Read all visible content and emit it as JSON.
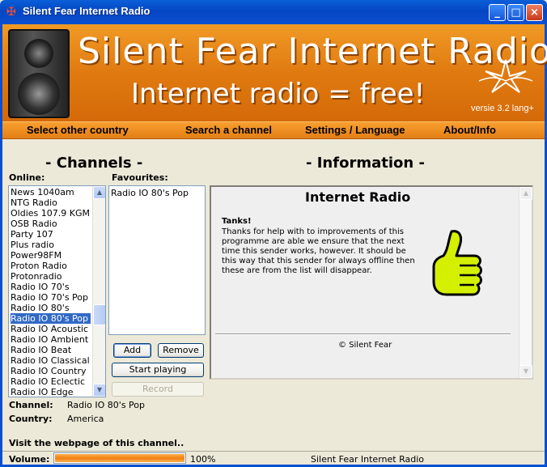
{
  "window": {
    "title": "Silent Fear Internet Radio",
    "icon": "app-logo-icon",
    "controls": {
      "minimize": "_",
      "maximize": "□",
      "close": "×"
    }
  },
  "banner": {
    "title": "Silent Fear Internet Radio",
    "slogan": "Internet radio = free!",
    "version": "versie 3.2 lang+"
  },
  "menu": {
    "items": [
      "Select other country",
      "Search a channel",
      "Settings / Language",
      "About/Info"
    ]
  },
  "channels": {
    "heading": "- Channels -",
    "online_label": "Online:",
    "favourites_label": "Favourites:",
    "online": [
      "News 1040am",
      "NTG Radio",
      "Oldies 107.9 KGM",
      "OSB Radio",
      "Party 107",
      "Plus radio",
      "Power98FM",
      "Proton Radio",
      "Protonradio",
      "Radio IO 70's",
      "Radio IO 70's Pop",
      "Radio IO 80's",
      "Radio IO 80's Pop",
      "Radio IO Acoustic",
      "Radio IO Ambient",
      "Radio IO Beat",
      "Radio IO Classical",
      "Radio IO Country",
      "Radio IO Eclectic",
      "Radio IO Edge"
    ],
    "selected_online": "Radio IO 80's Pop",
    "favourites": [
      "Radio IO 80's Pop"
    ]
  },
  "buttons": {
    "add": "Add",
    "remove": "Remove",
    "start": "Start playing",
    "record": "Record"
  },
  "details": {
    "channel_label": "Channel:",
    "channel_value": "Radio IO 80's Pop",
    "country_label": "Country:",
    "country_value": "America"
  },
  "information": {
    "heading": "- Information -",
    "title": "Internet Radio",
    "subtitle": "Tanks!",
    "body": "Thanks for help with to improvements of this programme are able we ensure that the next time this sender works, however. It should be this way that this sender for always offline then these are from the list will disappear.",
    "copyright": "© Silent Fear"
  },
  "footer": {
    "link": "Visit the webpage of this channel..",
    "volume_label": "Volume:",
    "volume_percent": "100%",
    "volume_level": 1.0,
    "status": "Silent Fear Internet Radio"
  },
  "colors": {
    "banner": "#e07a10",
    "selection": "#316ac5",
    "titlebar": "#0546c4"
  }
}
